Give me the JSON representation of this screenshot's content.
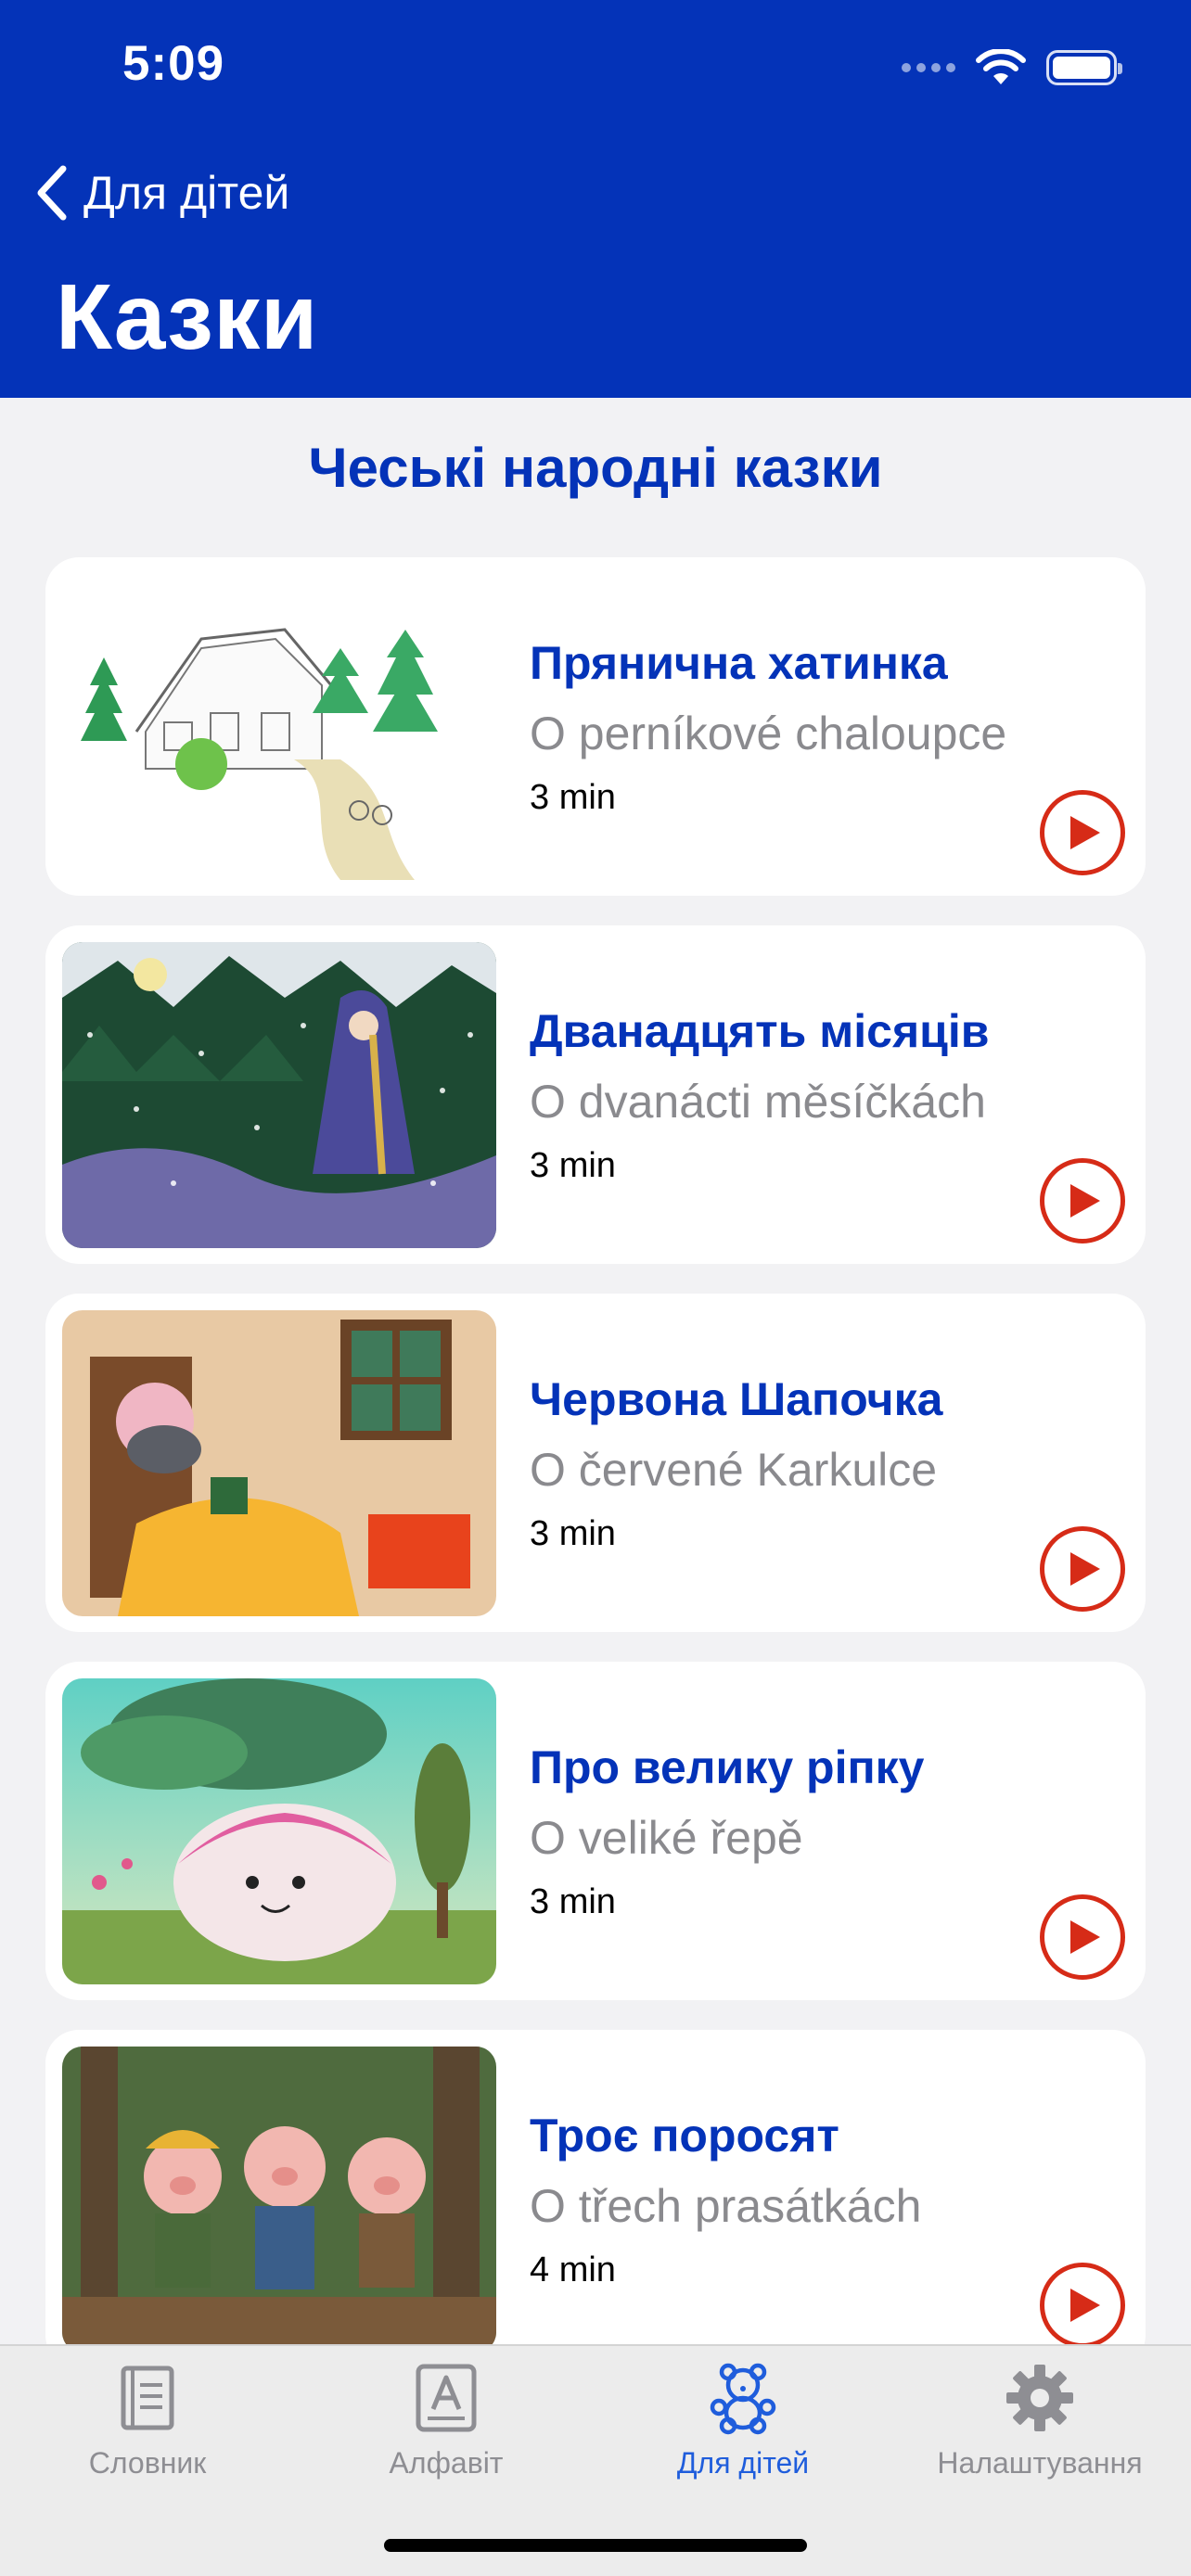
{
  "status_bar": {
    "time": "5:09"
  },
  "nav": {
    "back_label": "Для дітей",
    "title": "Казки"
  },
  "section": {
    "title": "Чеські народні казки"
  },
  "stories": [
    {
      "title_uk": "Прянична хатинка",
      "title_cz": "O perníkové chaloupce",
      "duration": "3 min",
      "image": "gingerbread-house-drawing"
    },
    {
      "title_uk": "Дванадцять місяців",
      "title_cz": "O dvanácti měsíčkách",
      "duration": "3 min",
      "image": "girl-in-snowy-forest"
    },
    {
      "title_uk": "Червона Шапочка",
      "title_cz": "O červené Karkulce",
      "duration": "3 min",
      "image": "wolf-in-grandmother-bed"
    },
    {
      "title_uk": "Про велику ріпку",
      "title_cz": "O veliké řepě",
      "duration": "3 min",
      "image": "giant-turnip"
    },
    {
      "title_uk": "Троє поросят",
      "title_cz": "O třech prasátkách",
      "duration": "4 min",
      "image": "three-little-pigs"
    }
  ],
  "tabbar": {
    "tabs": [
      {
        "label": "Словник",
        "icon": "book-icon",
        "active": false
      },
      {
        "label": "Алфавіт",
        "icon": "alphabet-icon",
        "active": false
      },
      {
        "label": "Для дітей",
        "icon": "teddy-bear-icon",
        "active": true
      },
      {
        "label": "Налаштування",
        "icon": "gear-icon",
        "active": false
      }
    ]
  },
  "colors": {
    "brand_blue": "#0433b8",
    "play_red": "#d62b17",
    "tab_active": "#1f5ddc"
  }
}
